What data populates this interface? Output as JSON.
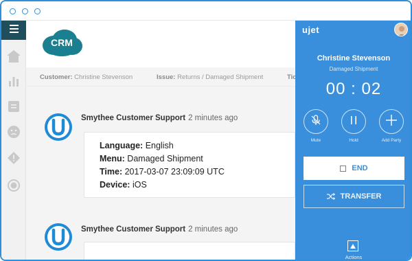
{
  "crm": {
    "logo_text": "CRM",
    "info": {
      "customer_label": "Customer:",
      "customer_value": "Christine Stevenson",
      "issue_label": "Issue:",
      "issue_value": "Returns / Damaged Shipment",
      "truncated_label": "Tic"
    },
    "messages": [
      {
        "author": "Smythee Customer Support",
        "time": "2 minutes ago",
        "fields": [
          {
            "label": "Language:",
            "value": "English"
          },
          {
            "label": "Menu:",
            "value": "Damaged Shipment"
          },
          {
            "label": "Time:",
            "value": "2017-03-07 23:09:09 UTC"
          },
          {
            "label": "Device:",
            "value": "iOS"
          }
        ]
      },
      {
        "author": "Smythee Customer Support",
        "time": "2 minutes ago"
      }
    ]
  },
  "phone": {
    "brand": "ujet",
    "caller_name": "Christine Stevenson",
    "caller_subtitle": "Damaged Shipment",
    "timer": "00 : 02",
    "controls": {
      "mute_label": "Mute",
      "hold_label": "Hold",
      "add_party_label": "Add Party"
    },
    "end_label": "END",
    "transfer_label": "TRANSFER",
    "actions_label": "Actions"
  },
  "colors": {
    "accent": "#3a8fdc",
    "sidebar_dark": "#1f4f5c",
    "crm_teal": "#1a7f8f",
    "brand_blue": "#1f8ad6"
  },
  "icons": {
    "sidebar": [
      "menu-icon",
      "home-icon",
      "bar-chart-icon",
      "document-icon",
      "face-icon",
      "warning-icon",
      "record-icon"
    ],
    "phone": [
      "mute-icon",
      "pause-icon",
      "plus-icon",
      "stop-icon",
      "shuffle-icon",
      "triangle-up-icon"
    ]
  }
}
